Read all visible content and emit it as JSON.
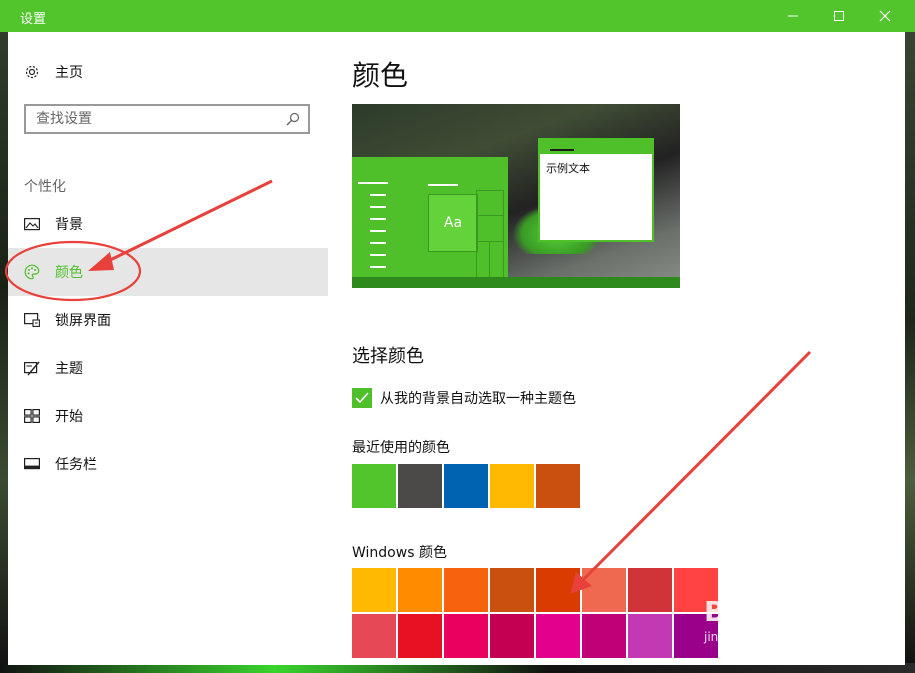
{
  "window": {
    "title": "设置",
    "controls": {
      "minimize": "—",
      "maximize": "☐",
      "close": "✕"
    }
  },
  "sidebar": {
    "home_label": "主页",
    "search_placeholder": "查找设置",
    "section_label": "个性化",
    "items": [
      {
        "label": "背景",
        "icon": "picture-icon",
        "active": false
      },
      {
        "label": "颜色",
        "icon": "palette-icon",
        "active": true
      },
      {
        "label": "锁屏界面",
        "icon": "lock-screen-icon",
        "active": false
      },
      {
        "label": "主题",
        "icon": "theme-icon",
        "active": false
      },
      {
        "label": "开始",
        "icon": "start-icon",
        "active": false
      },
      {
        "label": "任务栏",
        "icon": "taskbar-icon",
        "active": false
      }
    ]
  },
  "main": {
    "title": "颜色",
    "preview": {
      "tile_text": "Aa",
      "sample_text": "示例文本"
    },
    "choose_heading": "选择颜色",
    "auto_pick_label": "从我的背景自动选取一种主题色",
    "auto_pick_checked": true,
    "recent_label": "最近使用的颜色",
    "recent_colors": [
      "#52c52d",
      "#4c4a48",
      "#0063b1",
      "#ffb900",
      "#ca5010"
    ],
    "windows_colors_label": "Windows 颜色",
    "windows_colors": [
      [
        "#ffb900",
        "#ff8c00",
        "#f7630c",
        "#ca5010",
        "#da3b01",
        "#ef6950",
        "#d13438",
        "#ff4343"
      ],
      [
        "#e74856",
        "#e81123",
        "#ea005e",
        "#c30052",
        "#e3008c",
        "#bf0077",
        "#c239b3",
        "#9a0089"
      ]
    ]
  },
  "accent_color": "#52c52d",
  "annotation_color": "#e8403a",
  "watermark": {
    "logo": "Baidu经验",
    "url": "jingyan.baidu.com"
  }
}
